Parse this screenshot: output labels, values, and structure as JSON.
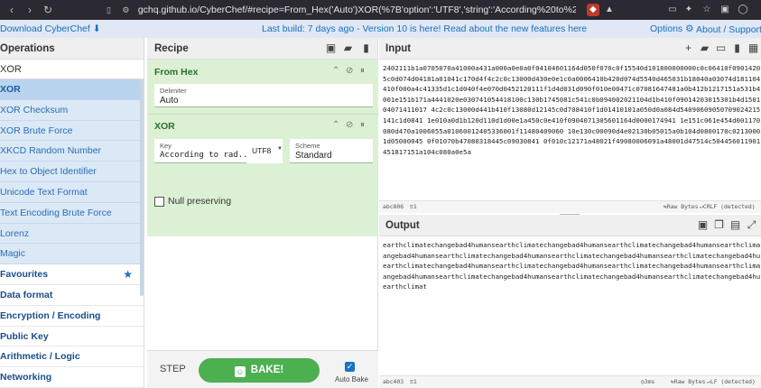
{
  "browser": {
    "url": "gchq.github.io/CyberChef/#recipe=From_Hex('Auto')XOR(%7B'option':'UTF8','string':'According%20to%20radiometric%20dating%2..."
  },
  "banner": {
    "download": "Download CyberChef",
    "message": "Last build: 7 days ago - Version 10 is here! Read about the new features here",
    "options": "Options",
    "about": "About / Support"
  },
  "operations": {
    "title": "Operations",
    "search_value": "XOR",
    "results": [
      "XOR",
      "XOR Checksum",
      "XOR Brute Force",
      "XKCD Random Number",
      "Hex to Object Identifier",
      "Unicode Text Format",
      "Text Encoding Brute Force",
      "Lorenz",
      "Magic"
    ],
    "categories": [
      "Favourites",
      "Data format",
      "Encryption / Encoding",
      "Public Key",
      "Arithmetic / Logic",
      "Networking"
    ]
  },
  "recipe": {
    "title": "Recipe",
    "from_hex": {
      "title": "From Hex",
      "delimiter_label": "Delimiter",
      "delimiter_value": "Auto"
    },
    "xor": {
      "title": "XOR",
      "key_label": "Key",
      "key_value": "According to rad...",
      "encoding": "UTF8",
      "scheme_label": "Scheme",
      "scheme_value": "Standard",
      "null_preserving": "Null preserving"
    },
    "step_label": "STEP",
    "bake_label": "BAKE!",
    "autobake_label": "Auto Bake"
  },
  "input": {
    "title": "Input",
    "lines": [
      "2402111b1a0705070a41000a431a000a0e0a0f04104601164d050f070c0f15540d101800000000c0c06410f0901420e1",
      "5c0d074d04181a01041c170d4f4c2c0c13000d430e0e1c0a0006410b420d074d5540d465031b18040a03074d181104111b",
      "410f000a4c41335d1c1d040f4e070d0452120111f1d4d031d090f010e00471c07081647481a0b412b1217151a531b430a",
      "001e151b171a4441020e030741054418100c130b1745081c541c0b094002021104d1b410f09014203015301b4d150153",
      "04071411017 4c2c0c13000d441b410f13080d12145c0d708410f1d01410101a050d0a084d54090609050709024215030",
      "141c1d0841 1e010a0d1b120d110d1d00e1a450c0e410f0904071305601164d0000174941 1e151c061e454d001170c0",
      "080d470a1006055a01060012405336001f11480409060 10e130c00090d4e02130b05015a0b104d0800170c0213000104e",
      "1d05000045 0f01070b47080318445c09030841 0f010c12171a48021f49080006091a48001d47514c50445601190108011c",
      "451817151a104c080a0e5a"
    ],
    "status_chars": "806",
    "status_lines": "1",
    "raw_bytes": "Raw Bytes",
    "crlf": "CRLF (detected)"
  },
  "output": {
    "title": "Output",
    "lines": [
      "earthclimatechangebad4humansearthclimatechangebad4humansearthclimatechangebad4humansearthclimatech",
      "angebad4humansearthclimatechangebad4humansearthclimatechangebad4humansearthclimatechangebad4humans",
      "earthclimatechangebad4humansearthclimatechangebad4humansearthclimatechangebad4humansearthclimatech",
      "angebad4humansearthclimatechangebad4humansearthclimatechangebad4humansearthclimatechangebad4humans",
      "earthclimat"
    ],
    "status_chars": "403",
    "status_lines": "1",
    "time": "3ms",
    "raw_bytes": "Raw Bytes",
    "lf": "LF (detected)"
  }
}
